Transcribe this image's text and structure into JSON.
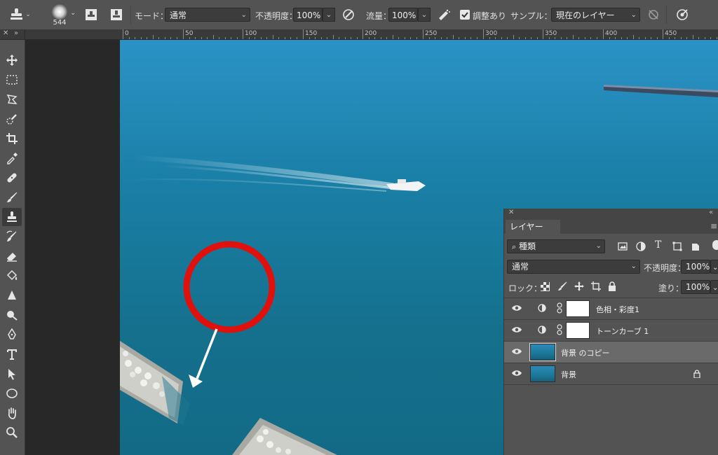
{
  "options_bar": {
    "brush_size": "544",
    "mode_label": "モード：",
    "mode_value": "通常",
    "opacity_label": "不透明度：",
    "opacity_value": "100%",
    "flow_label": "流量：",
    "flow_value": "100%",
    "aligned_label": "調整あり",
    "aligned_checked": true,
    "sample_label": "サンプル：",
    "sample_value": "現在のレイヤー"
  },
  "ruler": {
    "ticks": [
      "0",
      "50",
      "100",
      "150",
      "200",
      "250",
      "300",
      "350",
      "400",
      "450"
    ]
  },
  "toolbar": {
    "tools": [
      "move-icon",
      "marquee-icon",
      "lasso-icon",
      "quick-select-icon",
      "crop-icon",
      "eyedropper-icon",
      "healing-icon",
      "brush-icon",
      "clone-stamp-icon",
      "history-brush-icon",
      "eraser-icon",
      "paint-bucket-icon",
      "sharpen-icon",
      "dodge-icon",
      "pen-icon",
      "type-icon",
      "path-select-icon",
      "ellipse-icon",
      "hand-icon",
      "zoom-icon"
    ],
    "active_tool": "clone-stamp-icon"
  },
  "layers_panel": {
    "tab_label": "レイヤー",
    "filter_value": "種類",
    "blend_mode": "通常",
    "opacity_label": "不透明度：",
    "opacity_value": "100%",
    "lock_label": "ロック：",
    "fill_label": "塗り：",
    "fill_value": "100%",
    "layers": [
      {
        "name": "色相・彩度1",
        "type": "adjustment",
        "visible": true,
        "selected": false
      },
      {
        "name": "トーンカーブ 1",
        "type": "adjustment",
        "visible": true,
        "selected": false
      },
      {
        "name": "背景 のコピー",
        "type": "image",
        "visible": true,
        "selected": true
      },
      {
        "name": "背景",
        "type": "image",
        "visible": true,
        "selected": false,
        "locked": true
      }
    ]
  },
  "colors": {
    "panel_bg": "#535353",
    "canvas_sea": "#17708e",
    "annotation_red": "#e0100c",
    "annotation_arrow": "#ffffff"
  }
}
